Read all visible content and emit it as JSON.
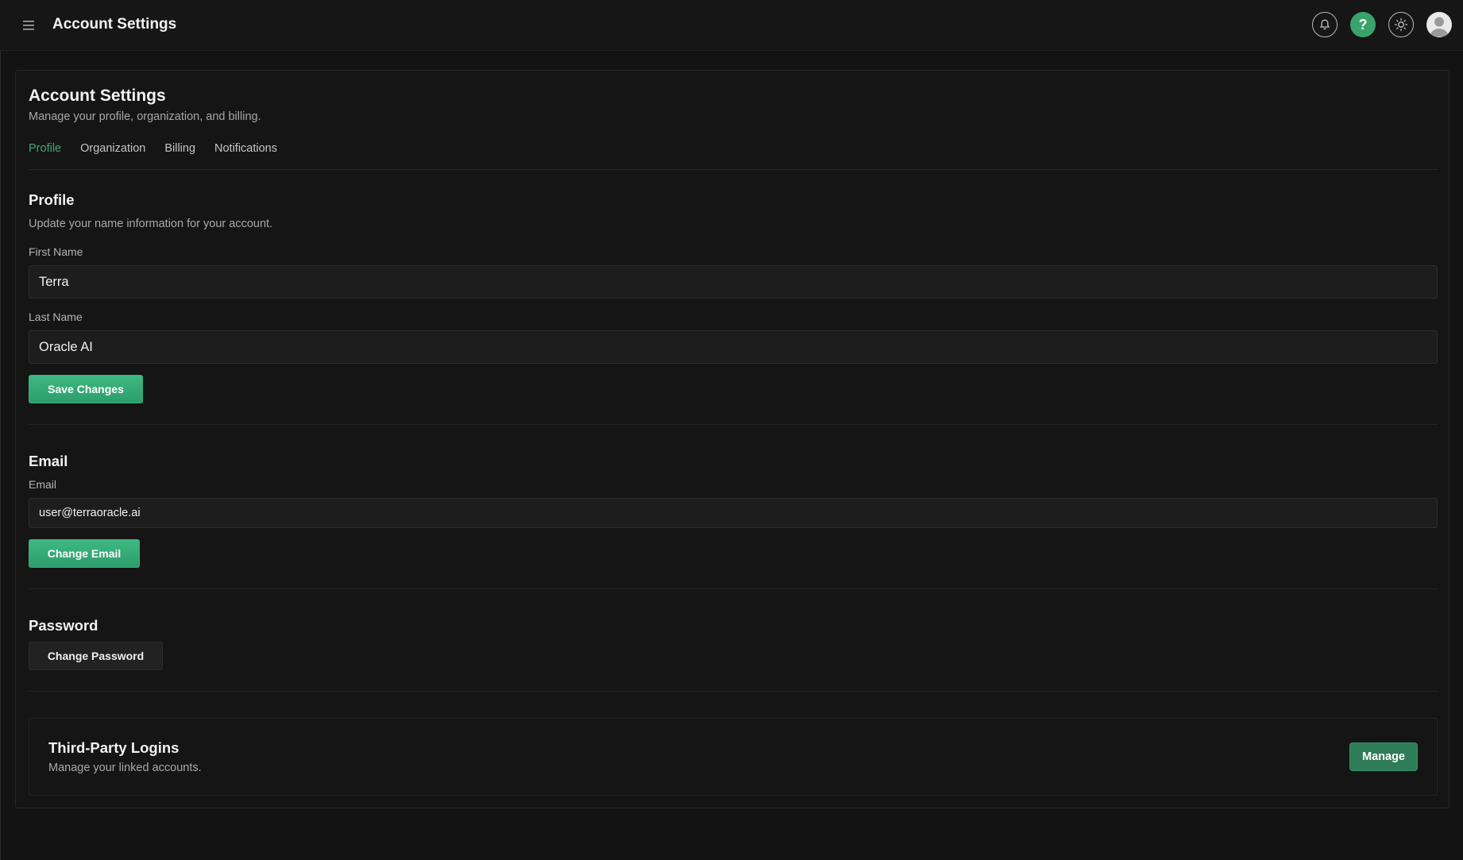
{
  "topbar": {
    "title": "Account Settings",
    "icons": [
      "menu-icon",
      "bell-icon",
      "help-icon",
      "sun-icon",
      "avatar-icon"
    ],
    "help_glyph": "?"
  },
  "header": {
    "title": "Account Settings",
    "subtitle": "Manage your profile, organization, and billing."
  },
  "tabs": [
    {
      "label": "Profile",
      "active": true
    },
    {
      "label": "Organization",
      "active": false
    },
    {
      "label": "Billing",
      "active": false
    },
    {
      "label": "Notifications",
      "active": false
    }
  ],
  "profile": {
    "title": "Profile",
    "description": "Update your name information for your account.",
    "first_name_label": "First Name",
    "first_name_value": "Terra",
    "last_name_label": "Last Name",
    "last_name_value": "Oracle AI",
    "save_label": "Save Changes"
  },
  "email": {
    "title": "Email",
    "field_label": "Email",
    "value": "user@terraoracle.ai",
    "change_label": "Change Email"
  },
  "password": {
    "title": "Password",
    "change_label": "Change Password"
  },
  "third_party": {
    "title": "Third-Party Logins",
    "description": "Manage your linked accounts.",
    "manage_label": "Manage"
  },
  "colors": {
    "accent": "#3fa877",
    "button_green": "#2c9e6b",
    "background": "#141414"
  }
}
